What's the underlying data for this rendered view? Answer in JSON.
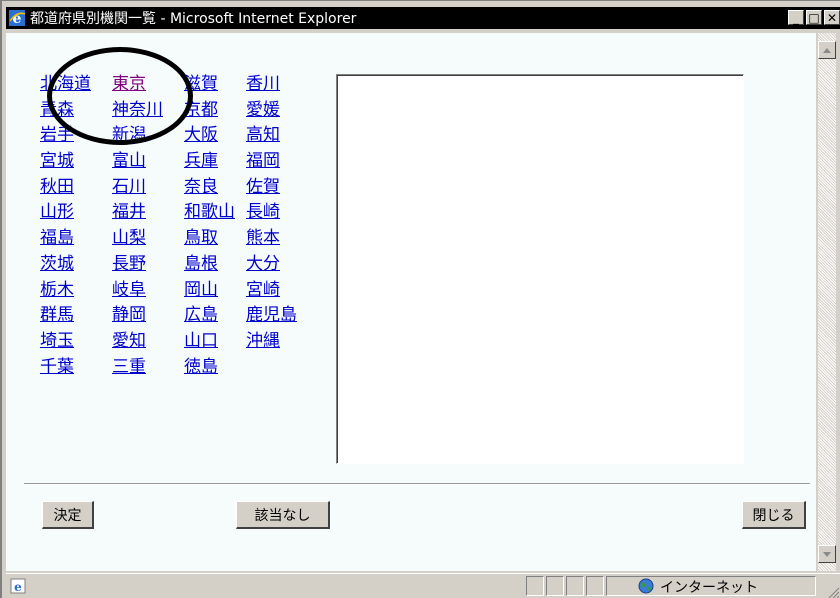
{
  "window": {
    "title": "都道府県別機関一覧 - Microsoft Internet Explorer",
    "min_glyph": "_",
    "max_glyph": "□",
    "close_glyph": "✕"
  },
  "prefectures": [
    {
      "label": "北海道",
      "visited": false
    },
    {
      "label": "東京",
      "visited": true
    },
    {
      "label": "滋賀",
      "visited": false
    },
    {
      "label": "香川",
      "visited": false
    },
    {
      "label": "青森",
      "visited": false
    },
    {
      "label": "神奈川",
      "visited": false
    },
    {
      "label": "京都",
      "visited": false
    },
    {
      "label": "愛媛",
      "visited": false
    },
    {
      "label": "岩手",
      "visited": false
    },
    {
      "label": "新潟",
      "visited": false
    },
    {
      "label": "大阪",
      "visited": false
    },
    {
      "label": "高知",
      "visited": false
    },
    {
      "label": "宮城",
      "visited": false
    },
    {
      "label": "富山",
      "visited": false
    },
    {
      "label": "兵庫",
      "visited": false
    },
    {
      "label": "福岡",
      "visited": false
    },
    {
      "label": "秋田",
      "visited": false
    },
    {
      "label": "石川",
      "visited": false
    },
    {
      "label": "奈良",
      "visited": false
    },
    {
      "label": "佐賀",
      "visited": false
    },
    {
      "label": "山形",
      "visited": false
    },
    {
      "label": "福井",
      "visited": false
    },
    {
      "label": "和歌山",
      "visited": false
    },
    {
      "label": "長崎",
      "visited": false
    },
    {
      "label": "福島",
      "visited": false
    },
    {
      "label": "山梨",
      "visited": false
    },
    {
      "label": "鳥取",
      "visited": false
    },
    {
      "label": "熊本",
      "visited": false
    },
    {
      "label": "茨城",
      "visited": false
    },
    {
      "label": "長野",
      "visited": false
    },
    {
      "label": "島根",
      "visited": false
    },
    {
      "label": "大分",
      "visited": false
    },
    {
      "label": "栃木",
      "visited": false
    },
    {
      "label": "岐阜",
      "visited": false
    },
    {
      "label": "岡山",
      "visited": false
    },
    {
      "label": "宮崎",
      "visited": false
    },
    {
      "label": "群馬",
      "visited": false
    },
    {
      "label": "静岡",
      "visited": false
    },
    {
      "label": "広島",
      "visited": false
    },
    {
      "label": "鹿児島",
      "visited": false
    },
    {
      "label": "埼玉",
      "visited": false
    },
    {
      "label": "愛知",
      "visited": false
    },
    {
      "label": "山口",
      "visited": false
    },
    {
      "label": "沖縄",
      "visited": false
    },
    {
      "label": "千葉",
      "visited": false
    },
    {
      "label": "三重",
      "visited": false
    },
    {
      "label": "徳島",
      "visited": false
    }
  ],
  "buttons": {
    "decide": "決定",
    "none": "該当なし",
    "close": "閉じる"
  },
  "status": {
    "zone": "インターネット"
  },
  "colors": {
    "link": "#0000cc",
    "visited_link": "#800080",
    "content_bg": "#f5fcfb",
    "chrome": "#d4d0c8"
  }
}
